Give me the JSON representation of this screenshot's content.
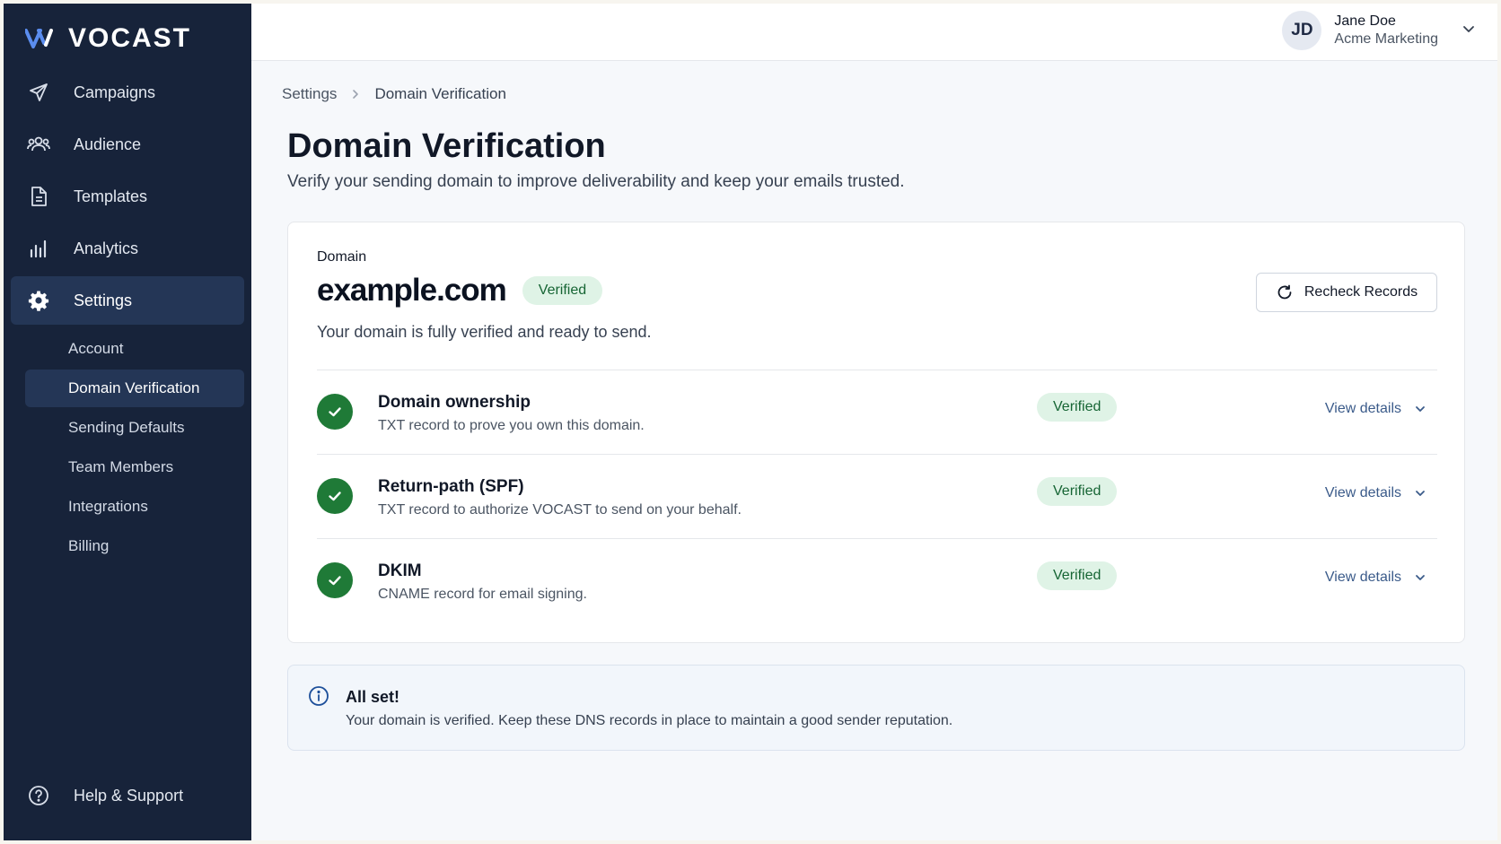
{
  "app": {
    "brand": "VOCAST"
  },
  "sidebar": {
    "items": [
      {
        "label": "Campaigns",
        "icon": "paper-plane-icon"
      },
      {
        "label": "Audience",
        "icon": "users-icon"
      },
      {
        "label": "Templates",
        "icon": "document-icon"
      },
      {
        "label": "Analytics",
        "icon": "bar-chart-icon"
      },
      {
        "label": "Settings",
        "icon": "gear-icon",
        "active": true
      }
    ],
    "sub_items": [
      {
        "label": "Account"
      },
      {
        "label": "Domain Verification",
        "active": true
      },
      {
        "label": "Sending Defaults"
      },
      {
        "label": "Team Members"
      },
      {
        "label": "Integrations"
      },
      {
        "label": "Billing"
      }
    ],
    "help": {
      "label": "Help & Support",
      "icon": "question-circle-icon"
    }
  },
  "user": {
    "initials": "JD",
    "name": "Jane Doe",
    "org": "Acme Marketing"
  },
  "breadcrumb": {
    "parent": "Settings",
    "current": "Domain Verification"
  },
  "page": {
    "title": "Domain Verification",
    "subtitle": "Verify your sending domain to improve deliverability and keep your emails trusted."
  },
  "domain": {
    "label": "Domain",
    "name": "example.com",
    "status": "Verified",
    "description": "Your domain is fully verified and ready to send.",
    "recheck_label": "Recheck Records"
  },
  "records": [
    {
      "title": "Domain ownership",
      "desc": "TXT record to prove you own this domain.",
      "status": "Verified",
      "action": "View details"
    },
    {
      "title": "Return-path (SPF)",
      "desc": "TXT record to authorize VOCAST to send on your behalf.",
      "status": "Verified",
      "action": "View details"
    },
    {
      "title": "DKIM",
      "desc": "CNAME record for email signing.",
      "status": "Verified",
      "action": "View details"
    }
  ],
  "alert": {
    "title": "All set!",
    "text": "Your domain is verified. Keep these DNS records in place to maintain a good sender reputation."
  },
  "colors": {
    "sidebar_bg": "#17233a",
    "active_bg": "#243656",
    "verified_bg": "#dff3e6",
    "verified_text": "#166534",
    "check_green": "#1f7a37",
    "link_blue": "#3b5b8a"
  }
}
